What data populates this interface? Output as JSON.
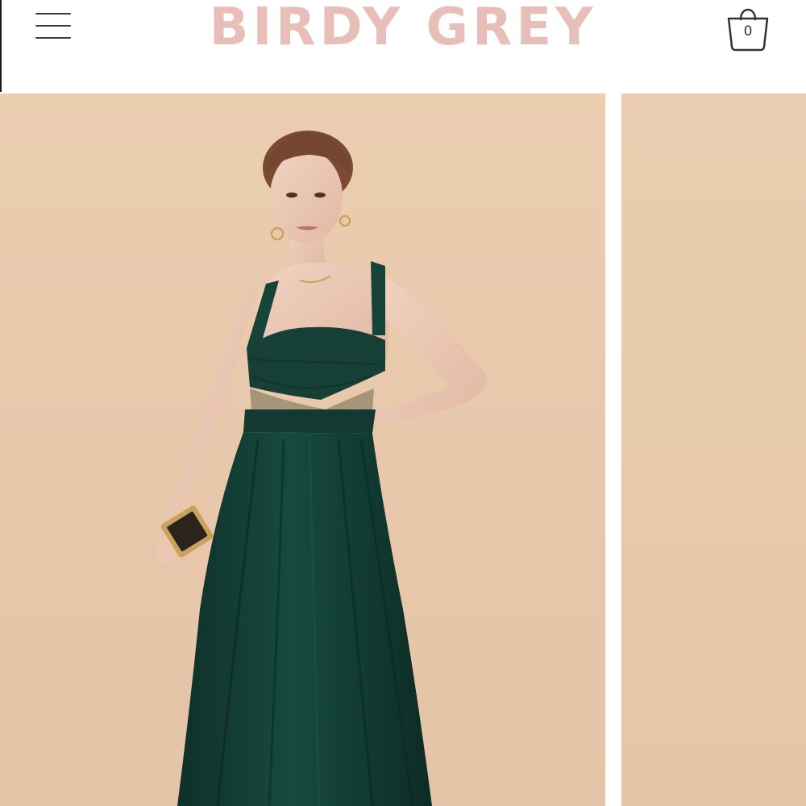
{
  "header": {
    "brand": "BIRDY GREY",
    "cart_count": "0",
    "menu_icon": "hamburger-menu-icon",
    "cart_icon": "shopping-bag-icon"
  },
  "gallery": {
    "main_image": "model-in-emerald-green-chiffon-maxi-dress",
    "next_image": "product-photo-beige-backdrop-partial"
  },
  "colors": {
    "brand": "#e8bfb8",
    "backdrop": "#e8c9aa",
    "dress": "#123d34",
    "icon": "#3a3a3a"
  }
}
